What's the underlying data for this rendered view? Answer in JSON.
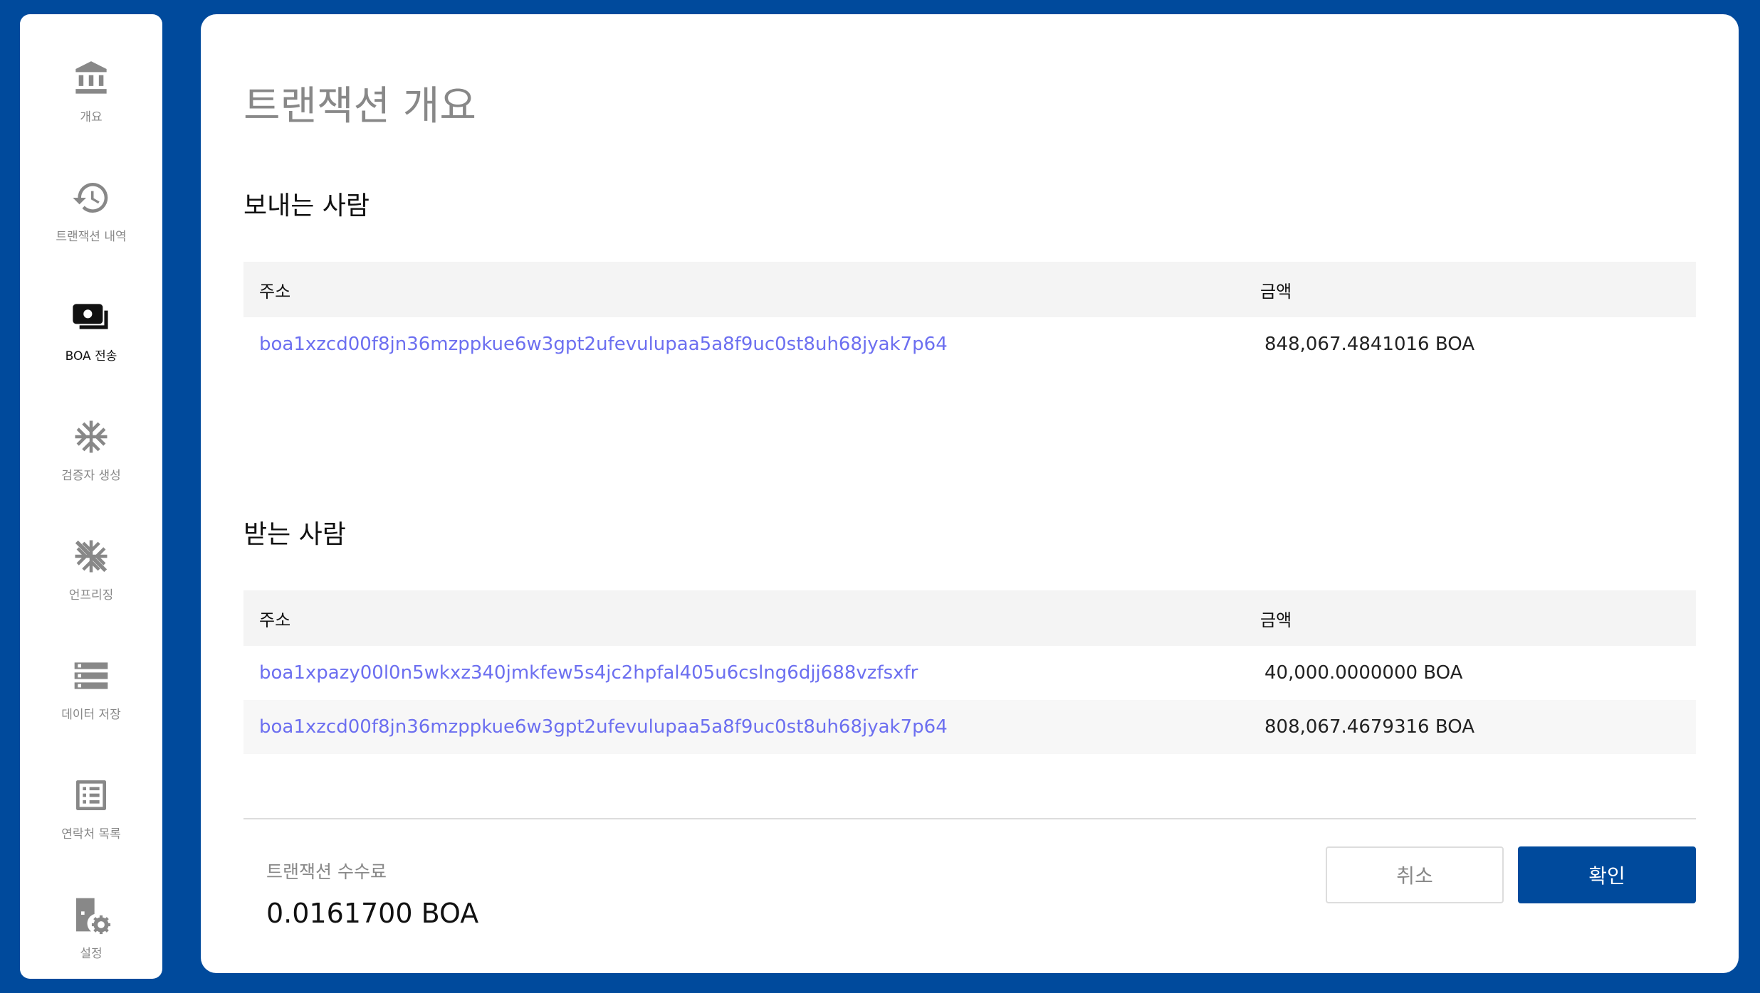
{
  "sidebar": {
    "items": [
      {
        "label": "개요",
        "icon": "bank-icon"
      },
      {
        "label": "트랜잭션 내역",
        "icon": "history-icon"
      },
      {
        "label": "BOA 전송",
        "icon": "money-transfer-icon"
      },
      {
        "label": "검증자 생성",
        "icon": "snowflake-icon"
      },
      {
        "label": "언프리징",
        "icon": "snowflake-off-icon"
      },
      {
        "label": "데이터 저장",
        "icon": "storage-icon"
      },
      {
        "label": "연락처 목록",
        "icon": "contact-list-icon"
      },
      {
        "label": "설정",
        "icon": "settings-icon"
      }
    ],
    "active_index": 2
  },
  "page": {
    "title": "트랜잭션 개요"
  },
  "sender": {
    "title": "보내는 사람",
    "header": {
      "address": "주소",
      "amount": "금액"
    },
    "rows": [
      {
        "address": "boa1xzcd00f8jn36mzppkue6w3gpt2ufevulupaa5a8f9uc0st8uh68jyak7p64",
        "amount": "848,067.4841016 BOA"
      }
    ]
  },
  "receiver": {
    "title": "받는 사람",
    "header": {
      "address": "주소",
      "amount": "금액"
    },
    "rows": [
      {
        "address": "boa1xpazy00l0n5wkxz340jmkfew5s4jc2hpfal405u6cslng6djj688vzfsxfr",
        "amount": "40,000.0000000 BOA"
      },
      {
        "address": "boa1xzcd00f8jn36mzppkue6w3gpt2ufevulupaa5a8f9uc0st8uh68jyak7p64",
        "amount": "808,067.4679316 BOA"
      }
    ]
  },
  "fee": {
    "label": "트랜잭션 수수료",
    "value": "0.0161700 BOA"
  },
  "buttons": {
    "cancel": "취소",
    "confirm": "확인"
  },
  "colors": {
    "brand": "#004a9c",
    "link": "#6c6ff0",
    "icon": "#888888",
    "icon_active": "#111111"
  }
}
